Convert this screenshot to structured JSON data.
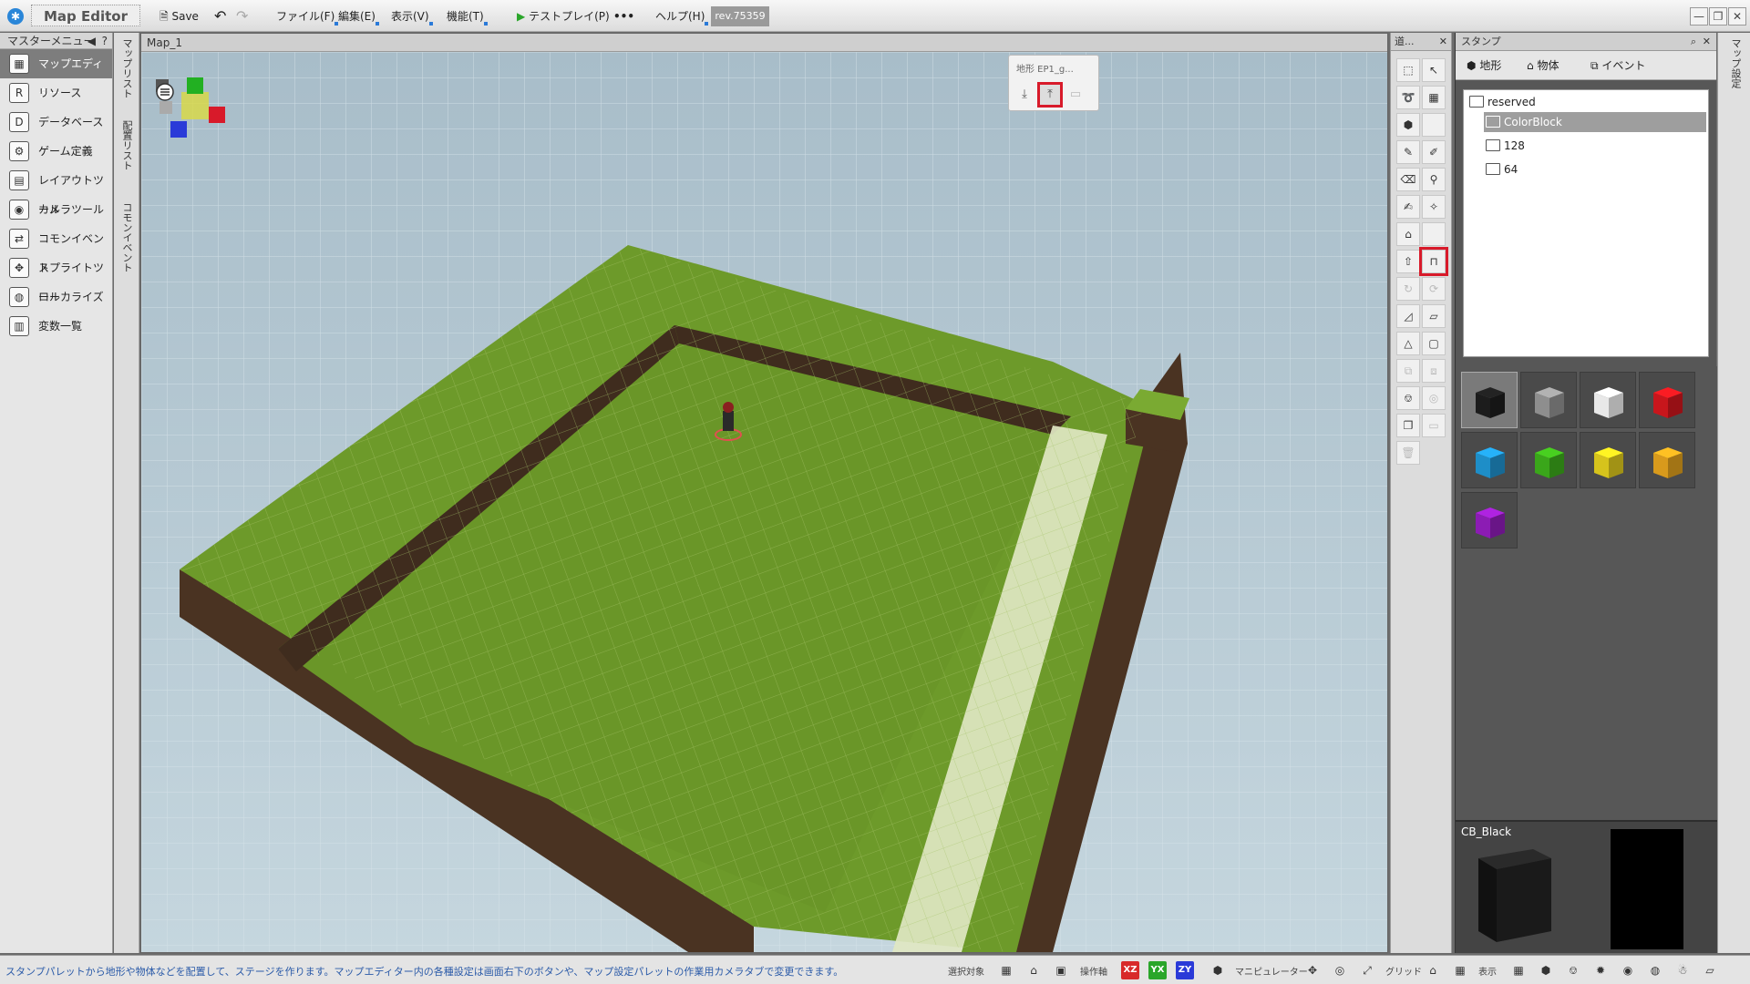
{
  "app": {
    "title": "Map Editor",
    "revision": "rev.75359"
  },
  "toolbar": {
    "save": "Save",
    "menus": [
      "ファイル(F)",
      "編集(E)",
      "表示(V)",
      "機能(T)"
    ],
    "testplay": "テストプレイ(P)",
    "more": "•••",
    "help": "ヘルプ(H)"
  },
  "master_menu": {
    "title": "マスターメニュー",
    "items": [
      "マップエディター",
      "リソース",
      "データベース",
      "ゲーム定義",
      "レイアウトツール",
      "カメラツール",
      "コモンイベント",
      "スプライトツール",
      "ローカライズ",
      "変数一覧"
    ]
  },
  "side_tabs": [
    "マップリスト",
    "配置リスト",
    "コモンイベント"
  ],
  "viewport": {
    "tab": "Map_1"
  },
  "tool_popup": {
    "title": "地形 EP1_g..."
  },
  "tool_panel": {
    "title": "道..."
  },
  "stamp_panel": {
    "title": "スタンプ",
    "tabs": [
      "地形",
      "物体",
      "イベント"
    ],
    "tree": [
      "reserved",
      "ColorBlock",
      "128",
      "64"
    ],
    "selected_tree_item": "ColorBlock",
    "swatches": [
      {
        "name": "black",
        "color": "#1c1c1c"
      },
      {
        "name": "gray",
        "color": "#8e8e8e"
      },
      {
        "name": "white",
        "color": "#e8e8e8"
      },
      {
        "name": "red",
        "color": "#c8161c"
      },
      {
        "name": "cyan",
        "color": "#1e8ec8"
      },
      {
        "name": "green",
        "color": "#3aa61a"
      },
      {
        "name": "yellow",
        "color": "#d6c31c"
      },
      {
        "name": "orange",
        "color": "#d89a1c"
      },
      {
        "name": "purple",
        "color": "#8c1cb4"
      }
    ],
    "selected_swatch": "black",
    "preview_label": "CB_Black"
  },
  "right_strip": "マップ設定",
  "status": {
    "message": "スタンプパレットから地形や物体などを配置して、ステージを作ります。マップエディター内の各種設定は画面右下のボタンや、マップ設定パレットの作業用カメラタブで変更できます。",
    "select_target": "選択対象",
    "axis": "操作軸",
    "axis_buttons": [
      "XZ",
      "YX",
      "ZY"
    ],
    "manipulator": "マニピュレーター",
    "grid": "グリッド",
    "display": "表示"
  },
  "colors": {
    "ground_top": "#6d9a2a",
    "ground_side": "#4a3322",
    "sky": "#b9cdd7",
    "highlight": "#d81a2a"
  }
}
